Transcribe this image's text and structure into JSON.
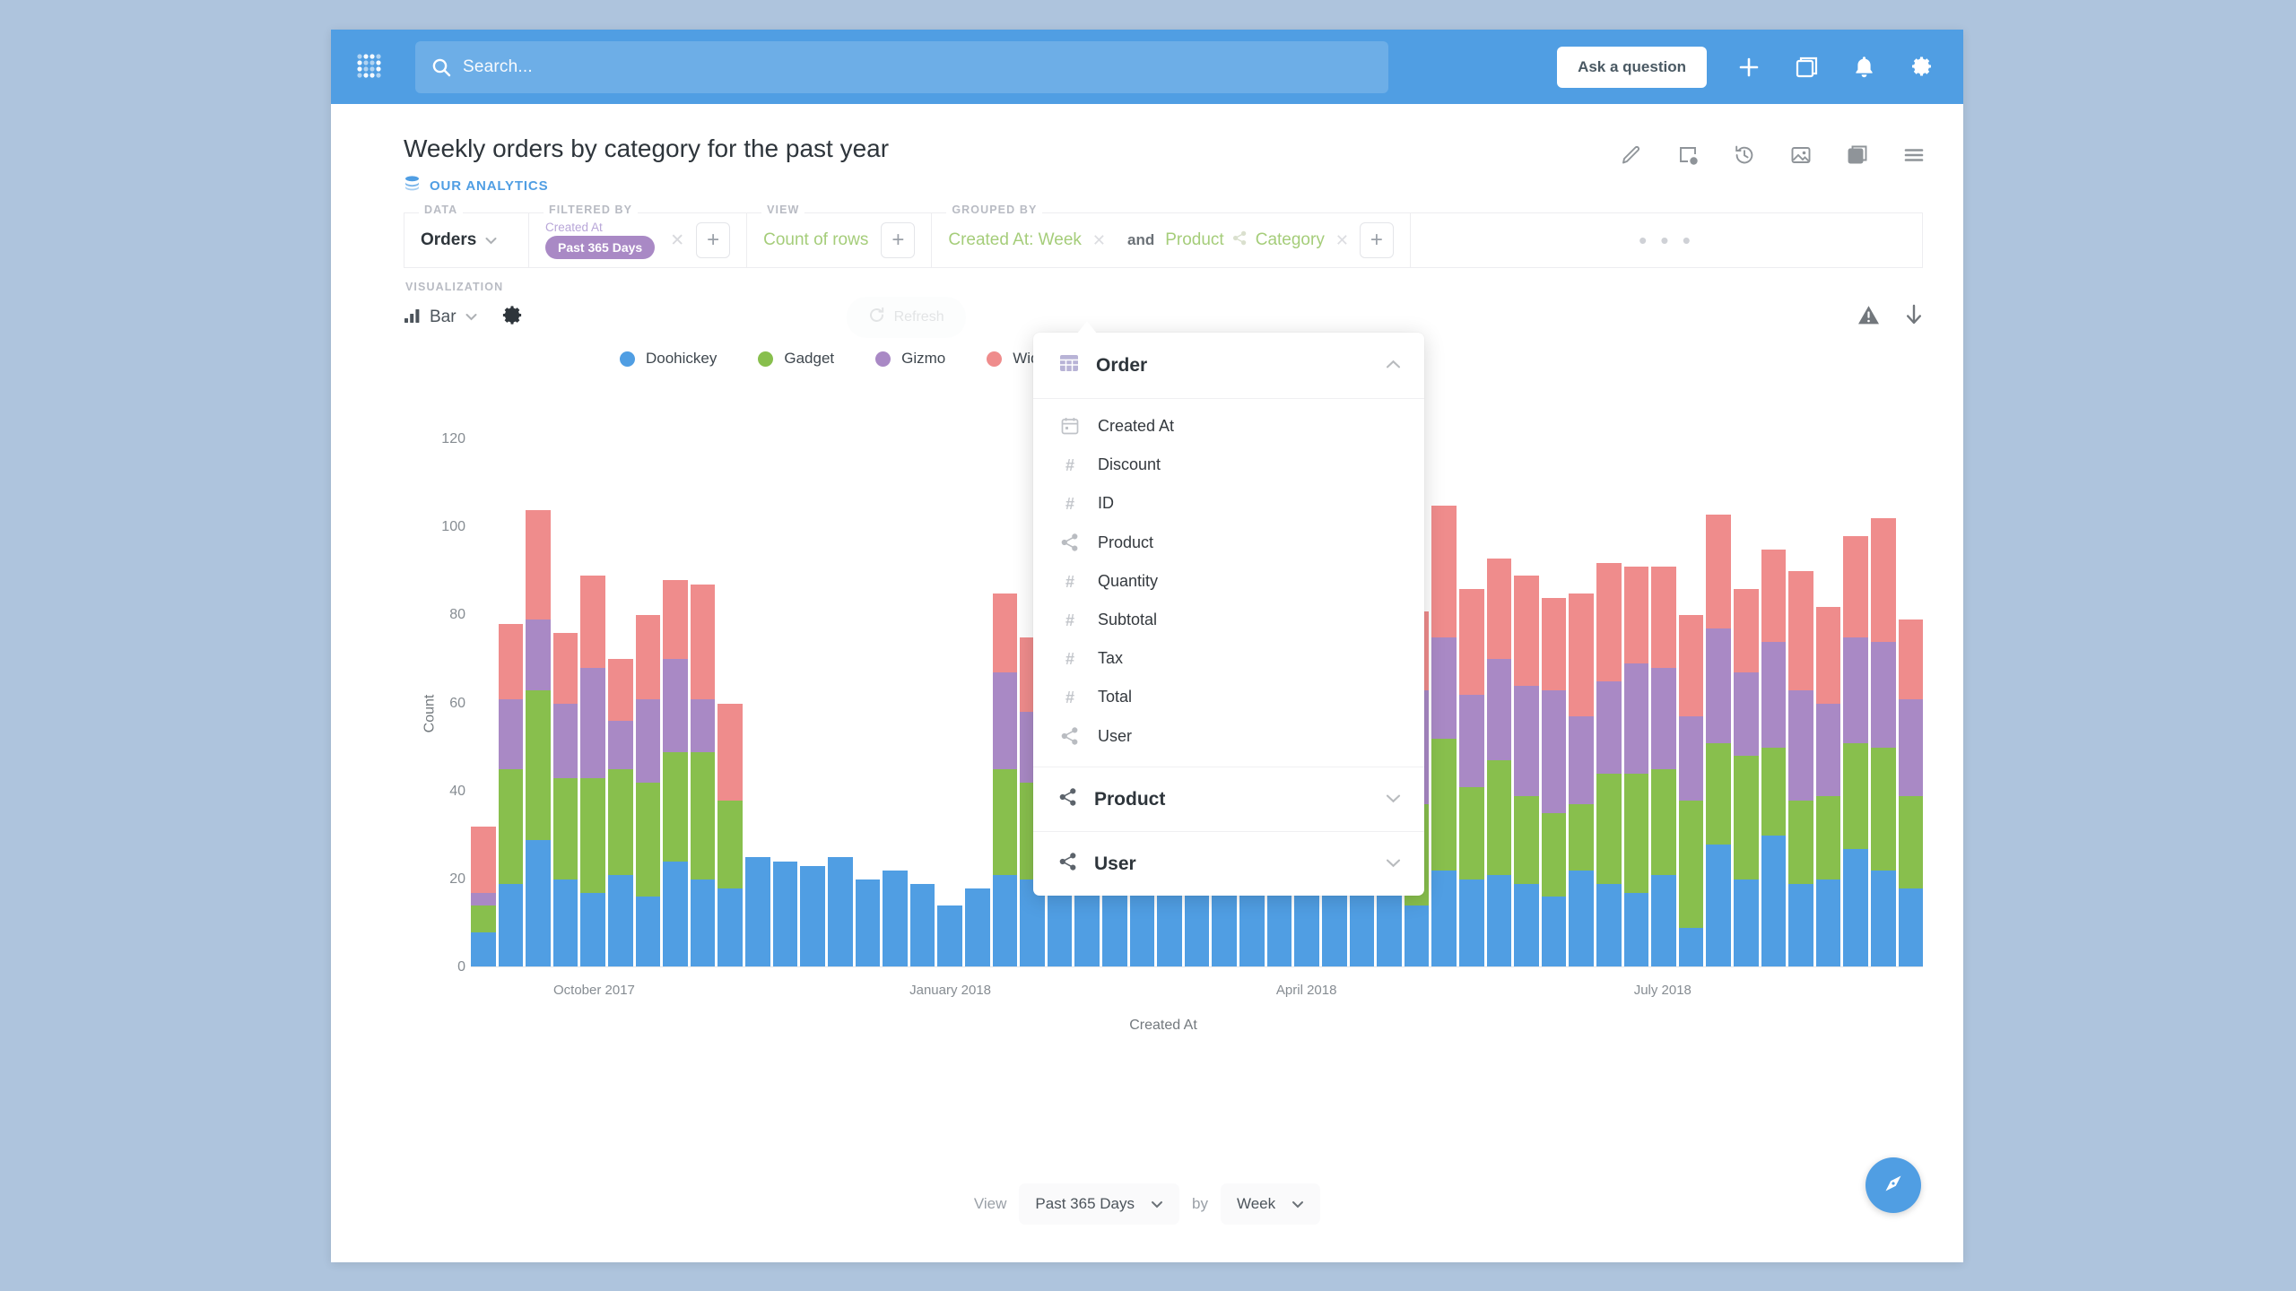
{
  "topnav": {
    "logo_icon": "metabase-logo-icon",
    "search_placeholder": "Search...",
    "search_icon": "search-icon",
    "ask_label": "Ask a question",
    "icons": [
      {
        "name": "plus-icon",
        "glyph": "+"
      },
      {
        "name": "new-dashboard-icon",
        "glyph": "❐"
      },
      {
        "name": "bell-icon",
        "glyph": "🔔"
      },
      {
        "name": "gear-icon",
        "glyph": "⚙"
      }
    ]
  },
  "question": {
    "title": "Weekly orders by category for the past year",
    "collection": "OUR ANALYTICS",
    "collection_icon": "collection-stack-icon",
    "actions": [
      {
        "name": "edit-pencil-icon"
      },
      {
        "name": "add-to-dashboard-icon"
      },
      {
        "name": "revision-history-icon"
      },
      {
        "name": "download-image-icon"
      },
      {
        "name": "bookmark-duplicate-icon"
      },
      {
        "name": "more-menu-icon"
      }
    ]
  },
  "querybar": {
    "data": {
      "label": "DATA",
      "value": "Orders"
    },
    "filtered_by": {
      "label": "FILTERED BY",
      "chip_title": "Created At",
      "chip_value": "Past 365 Days",
      "remove_glyph": "✕",
      "add_glyph": "+"
    },
    "view": {
      "label": "VIEW",
      "value": "Count of rows",
      "add_glyph": "+"
    },
    "grouped_by": {
      "label": "GROUPED BY",
      "first": "Created At: Week",
      "conjunction": "and",
      "second_table": "Product",
      "second_field": "Category",
      "remove_glyph": "✕",
      "add_glyph": "+"
    },
    "overflow": "• • •"
  },
  "vizbar": {
    "label": "VISUALIZATION",
    "type": "Bar",
    "settings_icon": "gear-icon",
    "refresh_label": "Refresh",
    "refresh_icon": "refresh-icon",
    "warning_icon": "warning-triangle-icon",
    "download_icon": "download-arrow-icon"
  },
  "popover": {
    "sections": [
      {
        "name": "Order",
        "icon": "table-icon",
        "expanded": true,
        "caret": "up",
        "items": [
          {
            "label": "Created At",
            "icon": "calendar-icon"
          },
          {
            "label": "Discount",
            "icon": "number-icon"
          },
          {
            "label": "ID",
            "icon": "number-icon"
          },
          {
            "label": "Product",
            "icon": "foreign-key-icon"
          },
          {
            "label": "Quantity",
            "icon": "number-icon"
          },
          {
            "label": "Subtotal",
            "icon": "number-icon"
          },
          {
            "label": "Tax",
            "icon": "number-icon"
          },
          {
            "label": "Total",
            "icon": "number-icon"
          },
          {
            "label": "User",
            "icon": "foreign-key-icon"
          }
        ]
      },
      {
        "name": "Product",
        "icon": "foreign-key-icon",
        "expanded": false,
        "caret": "down",
        "items": []
      },
      {
        "name": "User",
        "icon": "foreign-key-icon",
        "expanded": false,
        "caret": "down",
        "items": []
      }
    ]
  },
  "footer": {
    "view_word": "View",
    "range_value": "Past 365 Days",
    "by_word": "by",
    "unit_value": "Week",
    "compass_icon": "compass-nav-icon"
  },
  "colors": {
    "brand": "#509EE3",
    "doohickey": "#509EE3",
    "gadget": "#88BF4D",
    "gizmo": "#A989C5",
    "widget": "#EF8C8C",
    "filter_purple": "#A989C5",
    "green_text": "#A5CD7A"
  },
  "chart_data": {
    "type": "bar",
    "stacked": true,
    "title": "Weekly orders by category for the past year",
    "xlabel": "Created At",
    "ylabel": "Count",
    "ylim": [
      0,
      130
    ],
    "yticks": [
      0,
      20,
      40,
      60,
      80,
      100,
      120
    ],
    "grid": false,
    "legend_position": "top-left",
    "legend": [
      "Doohickey",
      "Gadget",
      "Gizmo",
      "Widget"
    ],
    "xtick_labels": [
      "October 2017",
      "January 2018",
      "April 2018",
      "July 2018"
    ],
    "xtick_indices": [
      4,
      17,
      30,
      43
    ],
    "series": [
      {
        "name": "Doohickey",
        "color": "#509EE3",
        "values": [
          8,
          19,
          29,
          20,
          17,
          21,
          16,
          24,
          20,
          18,
          25,
          24,
          23,
          25,
          20,
          22,
          19,
          14,
          18,
          21,
          20,
          22,
          22,
          24,
          25,
          22,
          25,
          29,
          23,
          18,
          17,
          24,
          22,
          20,
          14,
          22,
          20,
          21,
          19,
          16,
          22,
          19,
          17,
          21,
          9,
          28,
          20,
          30,
          19,
          20,
          27,
          22,
          18
        ]
      },
      {
        "name": "Gadget",
        "color": "#88BF4D",
        "values": [
          6,
          26,
          34,
          23,
          26,
          24,
          26,
          25,
          29,
          20,
          0,
          0,
          0,
          0,
          0,
          0,
          0,
          0,
          0,
          24,
          22,
          19,
          21,
          31,
          17,
          23,
          27,
          22,
          23,
          16,
          22,
          28,
          22,
          17,
          23,
          30,
          21,
          26,
          20,
          19,
          15,
          25,
          27,
          24,
          29,
          23,
          28,
          20,
          19,
          19,
          24,
          28,
          21
        ]
      },
      {
        "name": "Gizmo",
        "color": "#A989C5",
        "values": [
          3,
          16,
          16,
          17,
          25,
          11,
          19,
          21,
          12,
          0,
          0,
          0,
          0,
          0,
          0,
          0,
          0,
          0,
          0,
          22,
          16,
          19,
          23,
          17,
          22,
          25,
          22,
          23,
          24,
          23,
          25,
          21,
          26,
          22,
          26,
          23,
          21,
          23,
          25,
          28,
          20,
          21,
          25,
          23,
          19,
          26,
          19,
          24,
          25,
          21,
          24,
          24,
          22
        ]
      },
      {
        "name": "Widget",
        "color": "#EF8C8C",
        "values": [
          15,
          17,
          25,
          16,
          21,
          14,
          19,
          18,
          26,
          22,
          0,
          0,
          0,
          0,
          0,
          0,
          0,
          0,
          0,
          18,
          17,
          22,
          24,
          22,
          21,
          22,
          26,
          32,
          25,
          23,
          25,
          22,
          23,
          25,
          18,
          30,
          24,
          23,
          25,
          21,
          28,
          27,
          22,
          23,
          23,
          26,
          19,
          21,
          27,
          22,
          23,
          28,
          18
        ]
      }
    ]
  }
}
